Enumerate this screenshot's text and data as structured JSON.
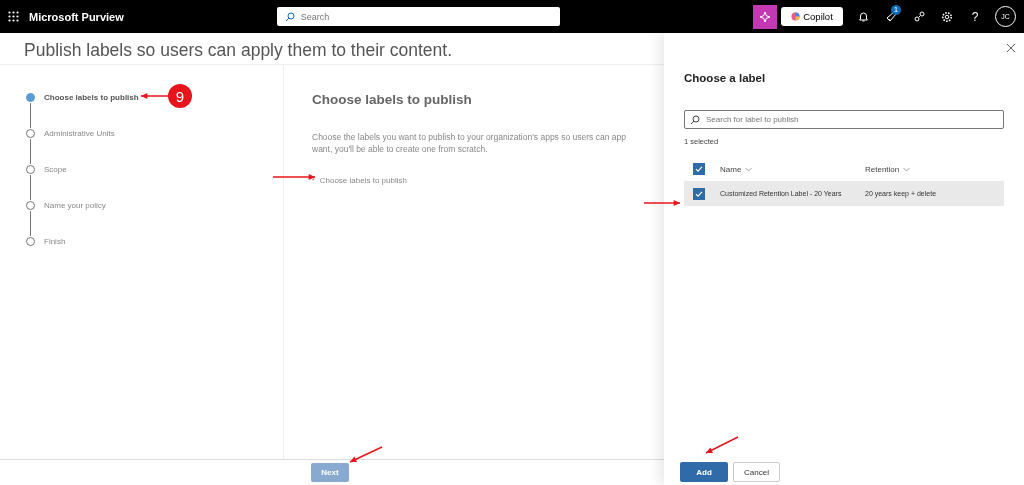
{
  "topbar": {
    "app_name": "Microsoft Purview",
    "search": {
      "placeholder": "Search"
    },
    "copilot_label": "Copilot",
    "notification_count": "1",
    "help_label": "?",
    "avatar_initials": "JC"
  },
  "page_title": "Publish labels so users can apply them to their content.",
  "steps": [
    {
      "label": "Choose labels to publish",
      "selected": true
    },
    {
      "label": "Administrative Units",
      "selected": false
    },
    {
      "label": "Scope",
      "selected": false
    },
    {
      "label": "Name your policy",
      "selected": false
    },
    {
      "label": "Finish",
      "selected": false
    }
  ],
  "content": {
    "heading": "Choose labels to publish",
    "description_lines": [
      "Choose the labels you want to publish to your organization's apps so users can app",
      "want, you'll be able to create one from scratch."
    ],
    "required_mark": "*",
    "link": "Choose labels to publish"
  },
  "footer": {
    "next": {
      "label": "Next",
      "disabled": true
    }
  },
  "panel": {
    "title": "Choose a label",
    "search": {
      "placeholder": "Search for label to publish"
    },
    "selected_count": "1 selected",
    "header_checked": true,
    "columns": [
      "Name",
      "Retention"
    ],
    "rows": [
      {
        "name": "Customized Retention Label - 20 Years",
        "retention": "20 years keep + delete",
        "selected": true
      }
    ],
    "buttons": [
      {
        "label": "Add",
        "kind": "primary"
      },
      {
        "label": "Cancel",
        "kind": "secondary"
      }
    ]
  },
  "annotation": {
    "step_number": "9"
  }
}
